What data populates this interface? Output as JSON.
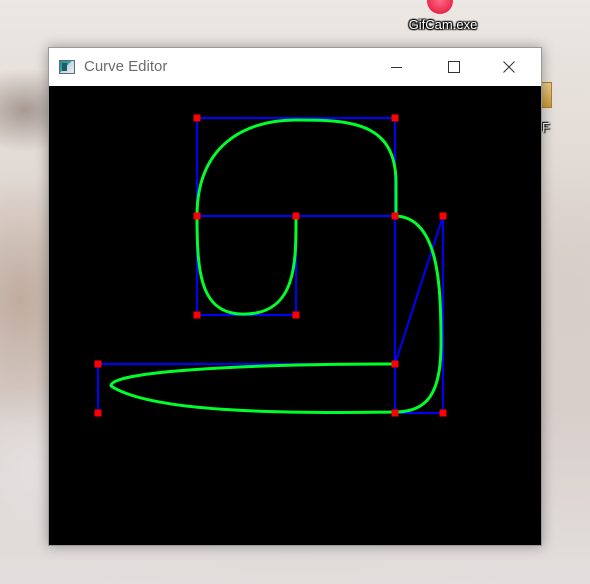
{
  "desktop": {
    "icon_label": "GifCam.exe",
    "peek_label": "F",
    "icon_name": "gifcam-icon"
  },
  "window": {
    "title": "Curve Editor",
    "app_icon": "curve-editor-app-icon",
    "controls": {
      "minimize": "minimize-icon",
      "maximize": "maximize-icon",
      "close": "close-icon"
    }
  },
  "canvas": {
    "background": "#000000",
    "curve_color": "#00ff2a",
    "hull_color": "#0000ff",
    "control_point_color": "#ff0000"
  }
}
